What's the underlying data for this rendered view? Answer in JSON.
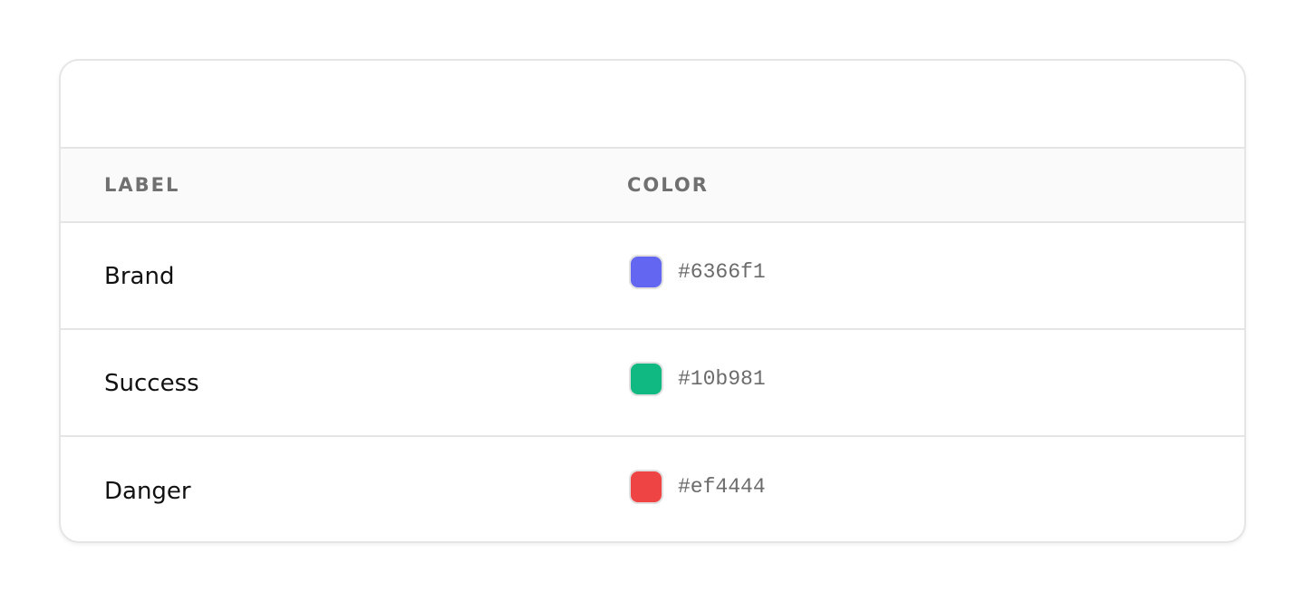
{
  "table": {
    "columns": {
      "label": "LABEL",
      "color": "COLOR"
    },
    "rows": [
      {
        "label": "Brand",
        "hex": "#6366f1",
        "color": "#6366f1"
      },
      {
        "label": "Success",
        "hex": "#10b981",
        "color": "#10b981"
      },
      {
        "label": "Danger",
        "hex": "#ef4444",
        "color": "#ef4444"
      }
    ]
  }
}
